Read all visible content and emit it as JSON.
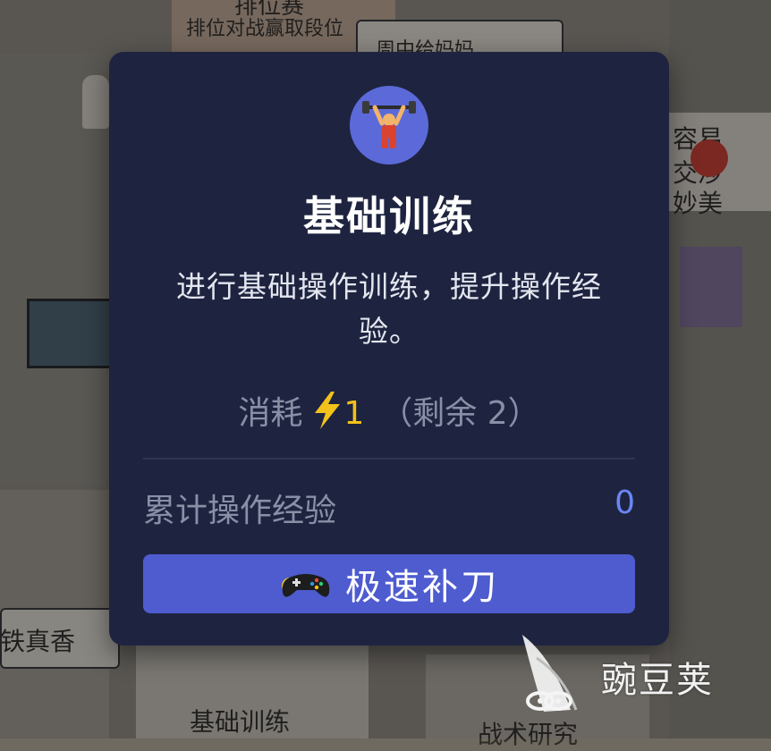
{
  "background": {
    "text_top": "排位对战赢取段位",
    "text_top_partial": "排位赛",
    "text_hidden": "周中给妈妈",
    "text_right_1": "容易",
    "text_right_2": "交涉",
    "text_right_3": "妙美",
    "text_left_tag": "铁真香",
    "card_bottom_1": "基础训练",
    "card_bottom_2": "战术研究"
  },
  "modal": {
    "icon": "weightlifter-icon",
    "title": "基础训练",
    "description": "进行基础操作训练，提升操作经验。",
    "cost_label": "消耗",
    "cost_icon": "lightning-icon",
    "cost_amount": "1",
    "remaining": "（剩余 2）",
    "exp_label": "累计操作经验",
    "exp_value": "0",
    "action_icon": "gamepad-icon",
    "action_label": "极速补刀"
  },
  "watermark": {
    "text": "豌豆荚",
    "logo": "wandoujia-logo"
  },
  "colors": {
    "modal_bg": "#1e2440",
    "accent_blue": "#4e5cd0",
    "cost_yellow": "#f3c21a",
    "value_blue": "#6a86f5"
  }
}
